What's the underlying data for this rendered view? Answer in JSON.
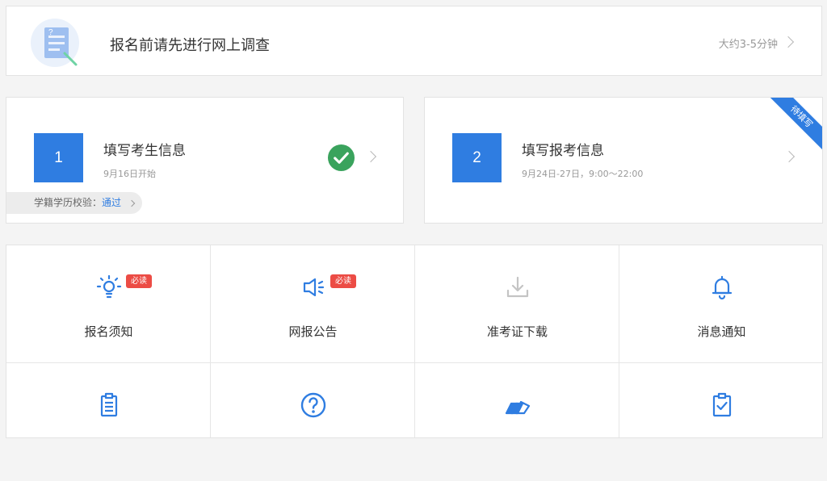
{
  "survey": {
    "title": "报名前请先进行网上调查",
    "duration": "大约3-5分钟"
  },
  "steps": [
    {
      "number": "1",
      "title": "填写考生信息",
      "subtitle": "9月16日开始",
      "status_icon": "check-circle-icon",
      "verify_label": "学籍学历校验：",
      "verify_status": "通过"
    },
    {
      "number": "2",
      "title": "填写报考信息",
      "subtitle": "9月24日-27日，9:00～22:00",
      "ribbon": "待填写"
    }
  ],
  "menu": [
    {
      "label": "报名须知",
      "icon": "lightbulb-icon",
      "badge": "必读"
    },
    {
      "label": "网报公告",
      "icon": "megaphone-icon",
      "badge": "必读"
    },
    {
      "label": "准考证下载",
      "icon": "download-icon",
      "disabled": true
    },
    {
      "label": "消息通知",
      "icon": "bell-icon"
    },
    {
      "label": "",
      "icon": "clipboard-list-icon"
    },
    {
      "label": "",
      "icon": "question-circle-icon"
    },
    {
      "label": "",
      "icon": "cards-icon"
    },
    {
      "label": "",
      "icon": "clipboard-check-icon"
    }
  ],
  "colors": {
    "accent": "#2f7de1",
    "badge": "#ec4c45",
    "success": "#3aa35d",
    "disabled": "#c4c4c4"
  }
}
